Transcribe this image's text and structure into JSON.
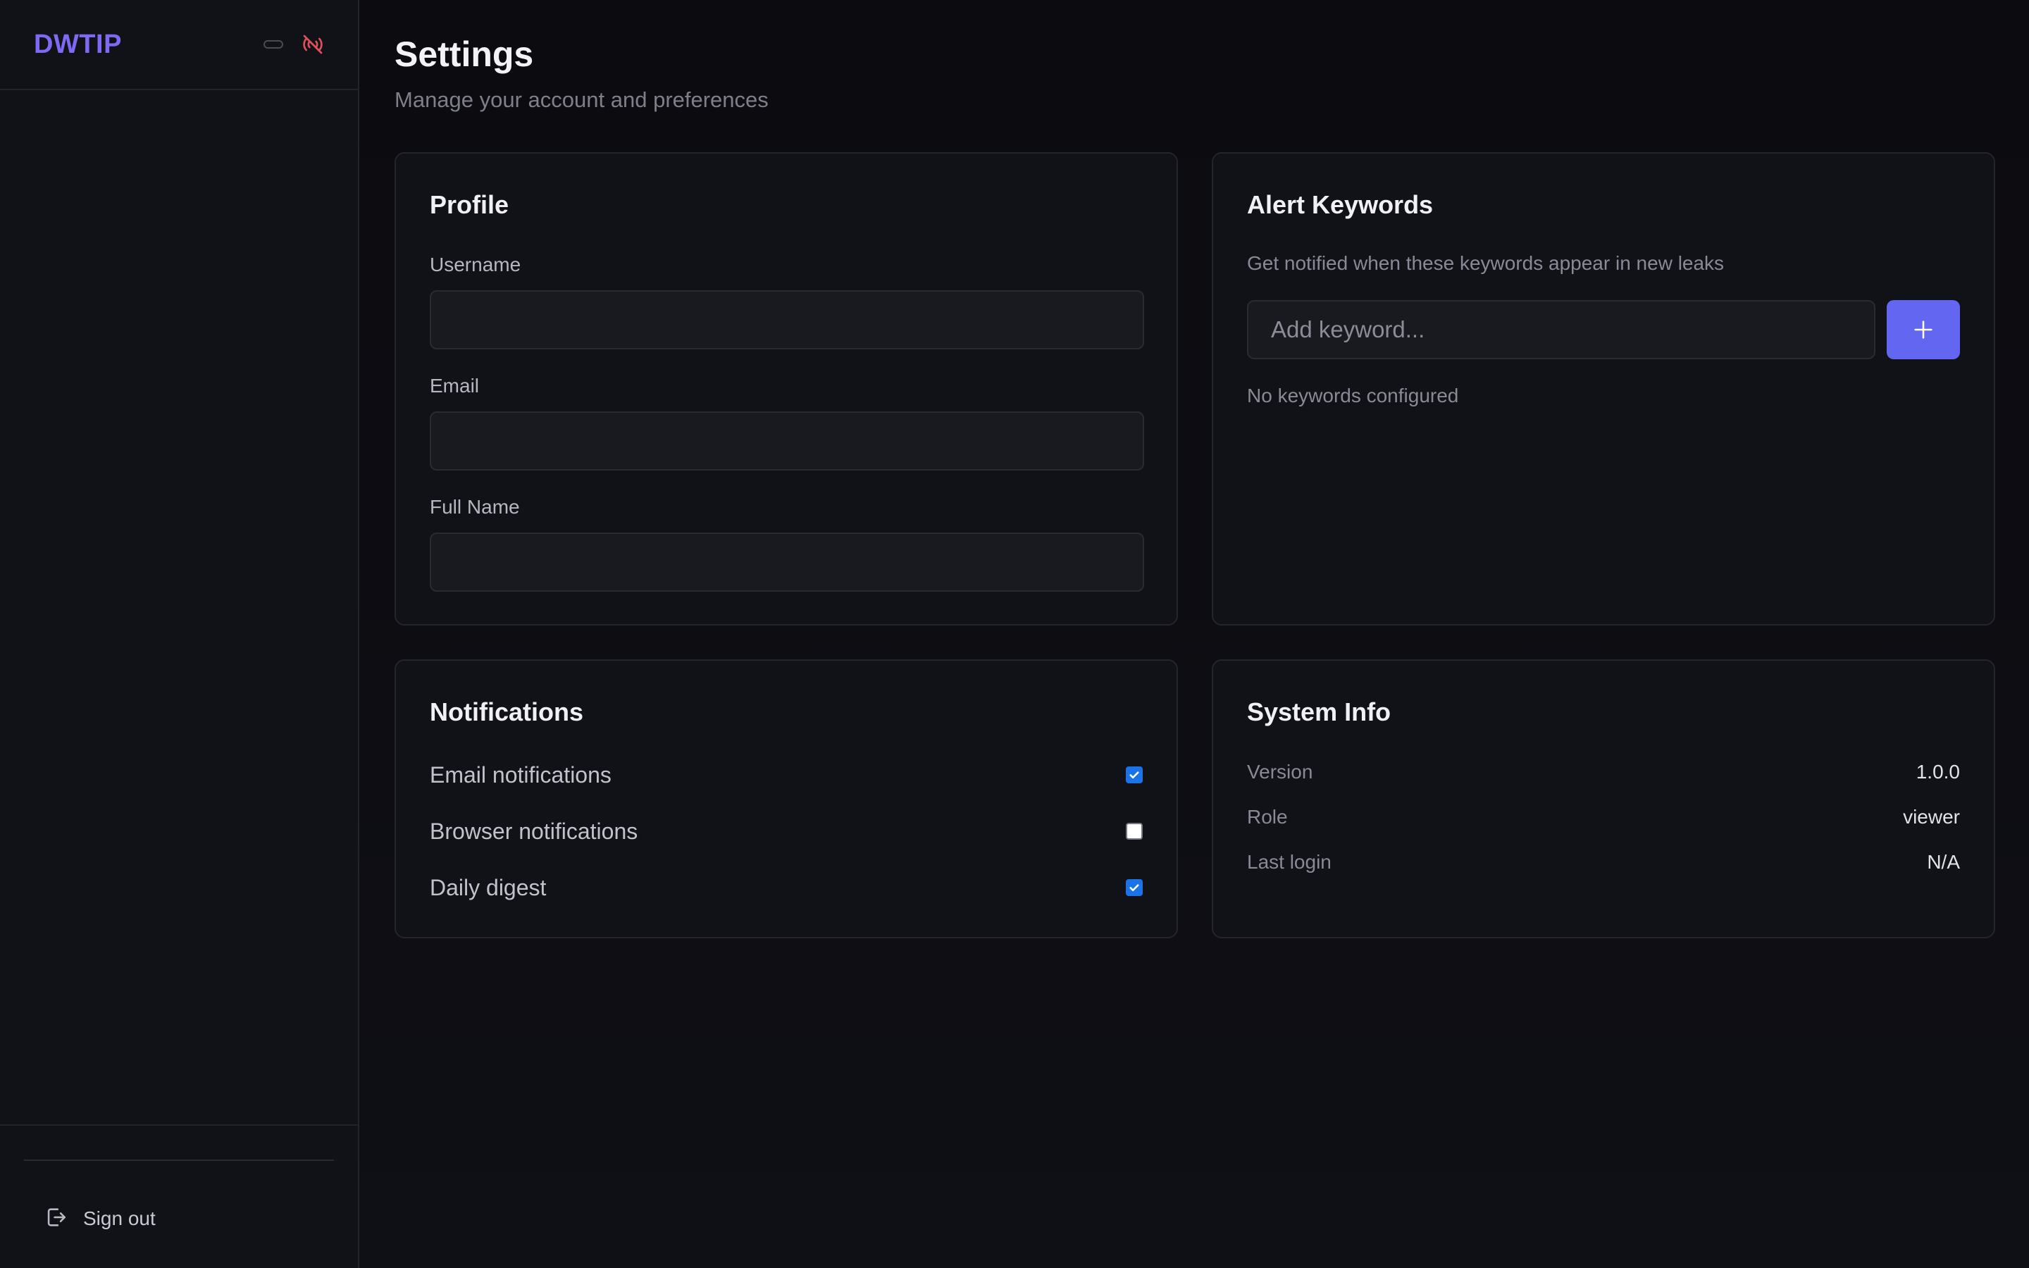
{
  "app": {
    "brand": "DWTIP",
    "icons": [
      "status-pill-icon",
      "wifi-off-icon"
    ],
    "colors": {
      "brand": "#7c6af2",
      "accent": "#6366f1",
      "offline": "#e0505a",
      "checkbox": "#1a73e8"
    }
  },
  "sidebar": {
    "signout_label": "Sign out",
    "signout_icon": "sign-out-icon"
  },
  "header": {
    "title": "Settings",
    "subtitle": "Manage your account and preferences"
  },
  "profile": {
    "title": "Profile",
    "username_label": "Username",
    "username_value": "",
    "email_label": "Email",
    "email_value": "",
    "fullname_label": "Full Name",
    "fullname_value": ""
  },
  "keywords": {
    "title": "Alert Keywords",
    "description": "Get notified when these keywords appear in new leaks",
    "input_placeholder": "Add keyword...",
    "add_icon": "plus-icon",
    "empty_text": "No keywords configured"
  },
  "notifications": {
    "title": "Notifications",
    "items": [
      {
        "label": "Email notifications",
        "checked": true
      },
      {
        "label": "Browser notifications",
        "checked": false
      },
      {
        "label": "Daily digest",
        "checked": true
      }
    ]
  },
  "system": {
    "title": "System Info",
    "rows": [
      {
        "key": "Version",
        "value": "1.0.0"
      },
      {
        "key": "Role",
        "value": "viewer"
      },
      {
        "key": "Last login",
        "value": "N/A"
      }
    ]
  }
}
